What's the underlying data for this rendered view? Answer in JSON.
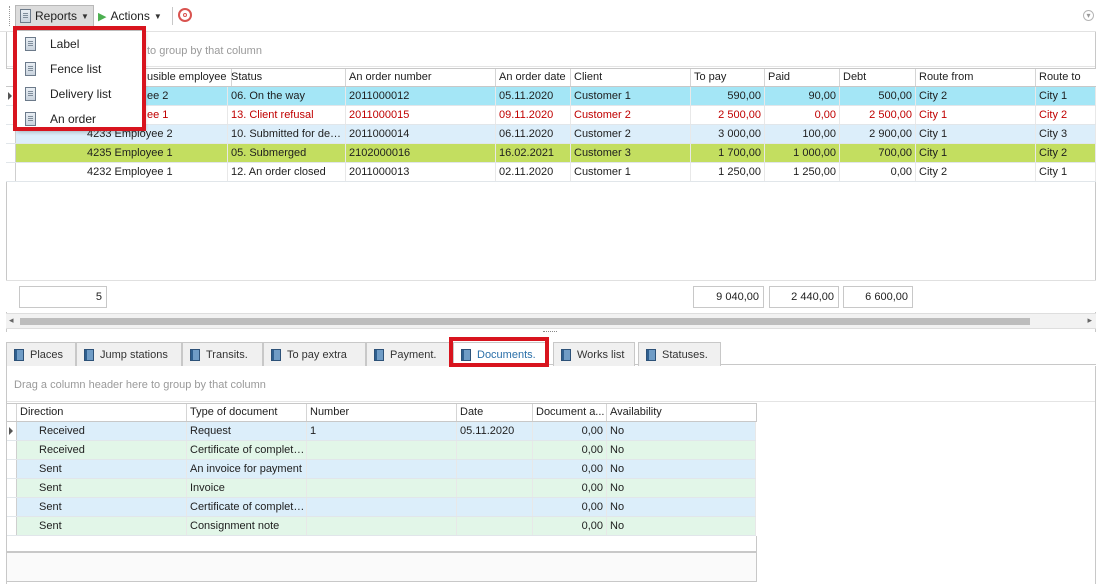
{
  "toolbar": {
    "reports_label": "Reports",
    "actions_label": "Actions"
  },
  "reports_menu": {
    "items": [
      {
        "label": "Label"
      },
      {
        "label": "Fence list"
      },
      {
        "label": "Delivery list"
      },
      {
        "label": "An order"
      }
    ]
  },
  "orders_grid": {
    "group_hint_visible": "to group by that column",
    "columns": [
      "usible employee",
      "Status",
      "An order number",
      "An order date",
      "Client",
      "To pay",
      "Paid",
      "Debt",
      "Route from",
      "Route to"
    ],
    "rows": [
      {
        "employee": "ee 2",
        "status": "06. On the way",
        "order_number": "2011000012",
        "order_date": "05.11.2020",
        "client": "Customer 1",
        "to_pay": "590,00",
        "paid": "90,00",
        "debt": "500,00",
        "route_from": "City 2",
        "route_to": "City 1"
      },
      {
        "employee": "ee 1",
        "status": "13. Client refusal",
        "order_number": "2011000015",
        "order_date": "09.11.2020",
        "client": "Customer 2",
        "to_pay": "2 500,00",
        "paid": "0,00",
        "debt": "2 500,00",
        "route_from": "City 1",
        "route_to": "City 2"
      },
      {
        "employee": "4233 Employee 2",
        "status": "10. Submitted for de…",
        "order_number": "2011000014",
        "order_date": "06.11.2020",
        "client": "Customer 2",
        "to_pay": "3 000,00",
        "paid": "100,00",
        "debt": "2 900,00",
        "route_from": "City 1",
        "route_to": "City 3"
      },
      {
        "employee": "4235 Employee 1",
        "status": "05. Submerged",
        "order_number": "2102000016",
        "order_date": "16.02.2021",
        "client": "Customer 3",
        "to_pay": "1 700,00",
        "paid": "1 000,00",
        "debt": "700,00",
        "route_from": "City 1",
        "route_to": "City 2"
      },
      {
        "employee": "4232 Employee 1",
        "status": "12. An order closed",
        "order_number": "2011000013",
        "order_date": "02.11.2020",
        "client": "Customer 1",
        "to_pay": "1 250,00",
        "paid": "1 250,00",
        "debt": "0,00",
        "route_from": "City 2",
        "route_to": "City 1"
      }
    ],
    "footer": {
      "count": "5",
      "to_pay_total": "9 040,00",
      "paid_total": "2 440,00",
      "debt_total": "6 600,00"
    }
  },
  "detail_tabs": [
    {
      "label": "Places"
    },
    {
      "label": "Jump stations"
    },
    {
      "label": "Transits."
    },
    {
      "label": "To pay extra"
    },
    {
      "label": "Payment."
    },
    {
      "label": "Documents."
    },
    {
      "label": "Works list"
    },
    {
      "label": "Statuses."
    }
  ],
  "documents_grid": {
    "group_hint": "Drag a column header here to group by that column",
    "columns": [
      "Direction",
      "Type of document",
      "Number",
      "Date",
      "Document a...",
      "Availability"
    ],
    "rows": [
      {
        "direction": "Received",
        "type": "Request",
        "number": "1",
        "date": "05.11.2020",
        "amount": "0,00",
        "availability": "No"
      },
      {
        "direction": "Received",
        "type": "Certificate of complet…",
        "number": "",
        "date": "",
        "amount": "0,00",
        "availability": "No"
      },
      {
        "direction": "Sent",
        "type": "An invoice for payment",
        "number": "",
        "date": "",
        "amount": "0,00",
        "availability": "No"
      },
      {
        "direction": "Sent",
        "type": "Invoice",
        "number": "",
        "date": "",
        "amount": "0,00",
        "availability": "No"
      },
      {
        "direction": "Sent",
        "type": "Certificate of complet…",
        "number": "",
        "date": "",
        "amount": "0,00",
        "availability": "No"
      },
      {
        "direction": "Sent",
        "type": "Consignment note",
        "number": "",
        "date": "",
        "amount": "0,00",
        "availability": "No"
      }
    ]
  },
  "colors": {
    "row_cyan": "#a4e6f6",
    "row_lightblue": "#dceefa",
    "row_green": "#c3de60",
    "row_mint": "#e2f6e8",
    "refusal_red": "#c00000",
    "highlight_red": "#d8141e",
    "active_tab_blue": "#2a6fa8"
  }
}
